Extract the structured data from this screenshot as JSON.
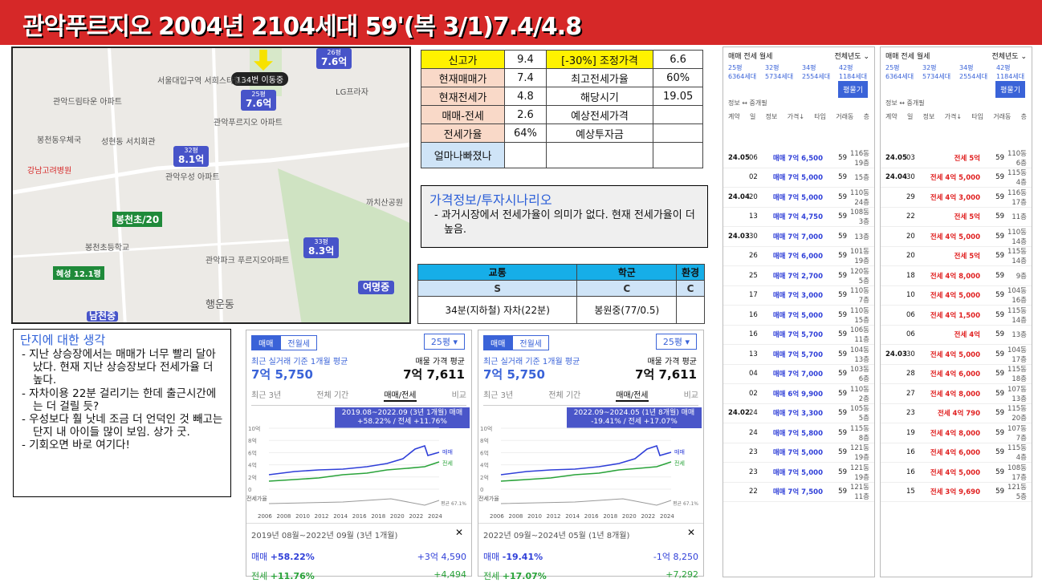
{
  "title": "관악푸르지오 2004년 2104세대 59'(복 3/1)7.4/4.8",
  "map": {
    "pins": [
      {
        "label": "7.6억",
        "sub": "26평"
      },
      {
        "label": "7.6억",
        "sub": "25평"
      },
      {
        "label": "8.1억",
        "sub": "32평"
      },
      {
        "label": "8.3억",
        "sub": "33평"
      }
    ],
    "tooltip": "134번 이동중",
    "labels": [
      "서울대입구역 서희스타힐스",
      "LG프라자",
      "관악드림타운 아파트",
      "관악푸르지오 아파트",
      "봉천동우체국",
      "성현동 서치회관",
      "강남고려병원",
      "관악우성 아파트",
      "봉천초등학교",
      "까치산공원",
      "관악파크 푸르지오아파트",
      "행운동"
    ],
    "flags": [
      "봉천초/20",
      "여명중",
      "남천중",
      "혜성 12.1평"
    ]
  },
  "price_table": {
    "rows": [
      [
        "신고가",
        "9.4",
        "[-30%] 조정가격",
        "6.6"
      ],
      [
        "현재매매가",
        "7.4",
        "최고전세가율",
        "60%"
      ],
      [
        "현재전세가",
        "4.8",
        "해당시기",
        "19.05"
      ],
      [
        "매매-전세",
        "2.6",
        "예상전세가격",
        ""
      ],
      [
        "전세가율",
        "64%",
        "예상투자금",
        ""
      ],
      [
        "얼마나빠졌나",
        "",
        "",
        ""
      ]
    ]
  },
  "scenario": {
    "heading": "가격정보/투자시나리오",
    "text": "과거시장에서 전세가율이 의미가 없다. 현재 전세가율이 더 높음."
  },
  "env_table": {
    "headers": [
      "교통",
      "학군",
      "환경"
    ],
    "grades": [
      "S",
      "C",
      "C"
    ],
    "details": [
      "34분(지하철) 자차(22분)",
      "봉원중(77/0.5)",
      ""
    ]
  },
  "thoughts": {
    "heading": "단지에 대한 생각",
    "items": [
      "지난 상승장에서는 매매가 너무 빨리 달아났다. 현재 지난 상승장보다 전세가율 더 높다.",
      "자차이용 22분 걸리기는 한데 출근시간에는 더 걸릴 듯?",
      "우성보다 훨 낫네 조금 더 언덕인 것 빼고는 단지 내 아이들 많이 보임. 상가 굿.",
      "기회오면 바로 여기다!"
    ]
  },
  "charts": [
    {
      "tabs": [
        "매매",
        "전월세"
      ],
      "size": "25평 ▾",
      "avg_label": "최근 실거래 기준 1개월 평균",
      "avg_value": "7억 5,750",
      "ask_label": "매물 가격 평균",
      "ask_value": "7억 7,611",
      "subtabs": [
        "최근 3년",
        "전체 기간",
        "매매/전세",
        "비교"
      ],
      "tip": "2019.08~2022.09 (3년 1개월) 매매 +58.22% / 전세 +11.76%",
      "period": "2019년 08월~2022년 09월 (3년 1개월)",
      "sale_label": "매매",
      "sale_pct": "+58.22%",
      "sale_amt": "+3억 4,590",
      "rent_label": "전세",
      "rent_pct": "+11.76%",
      "rent_amt": "+4,494",
      "years": [
        "2006",
        "2008",
        "2010",
        "2012",
        "2014",
        "2016",
        "2018",
        "2020",
        "2022",
        "2024"
      ],
      "y_ticks": [
        "10억",
        "8억",
        "6억",
        "4억",
        "2억",
        "0"
      ],
      "ratio_label": "전세가율",
      "avg_tag": "평균 67.1%",
      "legend_sale": "매매",
      "legend_rent": "전세"
    },
    {
      "tabs": [
        "매매",
        "전월세"
      ],
      "size": "25평 ▾",
      "avg_label": "최근 실거래 기준 1개월 평균",
      "avg_value": "7억 5,750",
      "ask_label": "매물 가격 평균",
      "ask_value": "7억 7,611",
      "subtabs": [
        "최근 3년",
        "전체 기간",
        "매매/전세",
        "비교"
      ],
      "tip": "2022.09~2024.05 (1년 8개월) 매매 -19.41% / 전세 +17.07%",
      "period": "2022년 09월~2024년 05월 (1년 8개월)",
      "sale_label": "매매",
      "sale_pct": "-19.41%",
      "sale_amt": "-1억 8,250",
      "rent_label": "전세",
      "rent_pct": "+17.07%",
      "rent_amt": "+7,292",
      "years": [
        "2006",
        "2008",
        "2010",
        "2012",
        "2014",
        "2016",
        "2018",
        "2020",
        "2022",
        "2024"
      ],
      "y_ticks": [
        "10억",
        "8억",
        "6억",
        "4억",
        "2억",
        "0"
      ],
      "ratio_label": "전세가율",
      "avg_tag": "평균 67.1%",
      "legend_sale": "매매",
      "legend_rent": "전세"
    }
  ],
  "sale_panel": {
    "tabs": "매매 전세 월세",
    "filter": "전체년도 ⌄",
    "sizes": [
      "25평 6364세대",
      "32평 5734세대",
      "34평 2554세대",
      "42평 1184세대"
    ],
    "button": "평물기",
    "sub": "정보 ↔ 중개필",
    "header": [
      "계약",
      "일",
      "정보",
      "가격↓",
      "타입",
      "거래동",
      "층"
    ],
    "rows": [
      [
        "24.05",
        "06",
        "매매 7억 6,500",
        "59",
        "116동",
        "19층"
      ],
      [
        "",
        "02",
        "매매 7억 5,000",
        "59",
        "",
        "15층"
      ],
      [
        "24.04",
        "20",
        "매매 7억 5,000",
        "59",
        "110동",
        "24층"
      ],
      [
        "",
        "13",
        "매매 7억 4,750",
        "59",
        "108동",
        "3층"
      ],
      [
        "24.03",
        "30",
        "매매 7억 7,000",
        "59",
        "",
        "13층"
      ],
      [
        "",
        "26",
        "매매 7억 6,000",
        "59",
        "101동",
        "19층"
      ],
      [
        "",
        "25",
        "매매 7억 2,700",
        "59",
        "120동",
        "5층"
      ],
      [
        "",
        "17",
        "매매 7억 3,000",
        "59",
        "110동",
        "7층"
      ],
      [
        "",
        "16",
        "매매 7억 5,000",
        "59",
        "110동",
        "15층"
      ],
      [
        "",
        "16",
        "매매 7억 5,700",
        "59",
        "106동",
        "11층"
      ],
      [
        "",
        "13",
        "매매 7억 5,700",
        "59",
        "104동",
        "13층"
      ],
      [
        "",
        "04",
        "매매 7억 7,000",
        "59",
        "103동",
        "6층"
      ],
      [
        "",
        "02",
        "매매 6억 9,900",
        "59",
        "110동",
        "2층"
      ],
      [
        "24.02",
        "24",
        "매매 7억 3,300",
        "59",
        "105동",
        "5층"
      ],
      [
        "",
        "24",
        "매매 7억 5,800",
        "59",
        "115동",
        "8층"
      ],
      [
        "",
        "23",
        "매매 7억 5,000",
        "59",
        "121동",
        "19층"
      ],
      [
        "",
        "23",
        "매매 7억 5,000",
        "59",
        "121동",
        "19층"
      ],
      [
        "",
        "22",
        "매매 7억 7,500",
        "59",
        "121동",
        "11층"
      ]
    ]
  },
  "rent_panel": {
    "tabs": "매매 전세 월세",
    "filter": "전체년도 ⌄",
    "sizes": [
      "25평 6364세대",
      "32평 5734세대",
      "34평 2554세대",
      "42평 1184세대"
    ],
    "button": "평물기",
    "sub": "정보 ↔ 중개필",
    "header": [
      "계약",
      "일",
      "정보",
      "가격↓",
      "타입",
      "거래동",
      "층"
    ],
    "rows": [
      [
        "24.05",
        "03",
        "전세 5억",
        "59",
        "110동",
        "6층"
      ],
      [
        "24.04",
        "30",
        "전세 4억 5,000",
        "59",
        "115동",
        "4층"
      ],
      [
        "",
        "29",
        "전세 4억 3,000",
        "59",
        "116동",
        "17층"
      ],
      [
        "",
        "22",
        "전세 5억",
        "59",
        "",
        "11층"
      ],
      [
        "",
        "20",
        "전세 4억 5,000",
        "59",
        "110동",
        "14층"
      ],
      [
        "",
        "20",
        "전세 5억",
        "59",
        "115동",
        "14층"
      ],
      [
        "",
        "18",
        "전세 4억 8,000",
        "59",
        "",
        "9층"
      ],
      [
        "",
        "10",
        "전세 4억 5,000",
        "59",
        "104동",
        "16층"
      ],
      [
        "",
        "06",
        "전세 4억 1,500",
        "59",
        "115동",
        "14층"
      ],
      [
        "",
        "06",
        "전세 4억",
        "59",
        "",
        "13층"
      ],
      [
        "24.03",
        "30",
        "전세 4억 5,000",
        "59",
        "104동",
        "17층"
      ],
      [
        "",
        "28",
        "전세 4억 6,000",
        "59",
        "115동",
        "18층"
      ],
      [
        "",
        "27",
        "전세 4억 8,000",
        "59",
        "107동",
        "13층"
      ],
      [
        "",
        "23",
        "전세 4억 790",
        "59",
        "115동",
        "20층"
      ],
      [
        "",
        "19",
        "전세 4억 8,000",
        "59",
        "107동",
        "7층"
      ],
      [
        "",
        "16",
        "전세 4억 6,000",
        "59",
        "115동",
        "4층"
      ],
      [
        "",
        "16",
        "전세 4억 5,000",
        "59",
        "108동",
        "17층"
      ],
      [
        "",
        "15",
        "전세 3억 9,690",
        "59",
        "121동",
        "5층"
      ]
    ]
  }
}
